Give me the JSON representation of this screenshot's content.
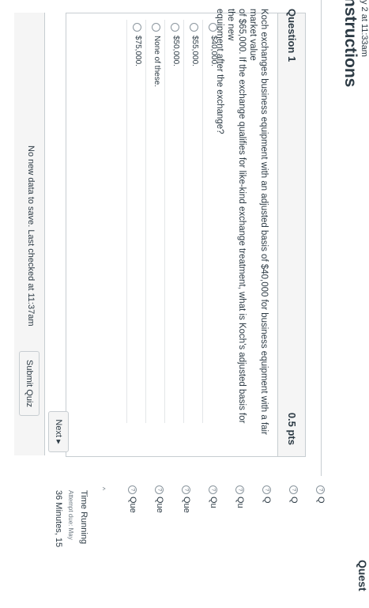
{
  "header": {
    "started_text": "y 2 at 11:33am",
    "title": "nstructions"
  },
  "question": {
    "title": "Question 1",
    "points": "0.5 pts",
    "text_lines": [
      "Koch exchanges business equipment with an adjusted basis of $40,000 for business equipment with a fair market value",
      "of $65,000. If the exchange qualifies for like-kind exchange treatment, what is Koch's adjusted basis for the new",
      "equipment after the exchange?"
    ],
    "answers": [
      {
        "label": "$40,000."
      },
      {
        "label": "$55,000."
      },
      {
        "label": "$50,000."
      },
      {
        "label": "None of these."
      },
      {
        "label": "$75,000."
      }
    ]
  },
  "next_button": {
    "label": "Next"
  },
  "footer": {
    "status": "No new data to save. Last checked at 11:37am",
    "submit_label": "Submit Quiz"
  },
  "sidebar": {
    "heading": "Quest",
    "items": [
      {
        "label": "Q"
      },
      {
        "label": "Q"
      },
      {
        "label": "Q"
      },
      {
        "label": "Qu"
      },
      {
        "label": "Qu"
      },
      {
        "label": "Que"
      },
      {
        "label": "Que"
      },
      {
        "label": "Que"
      }
    ],
    "timer_label": "Time Running",
    "attempt_due": "Attempt due: May",
    "time_remaining": "36 Minutes, 15"
  }
}
